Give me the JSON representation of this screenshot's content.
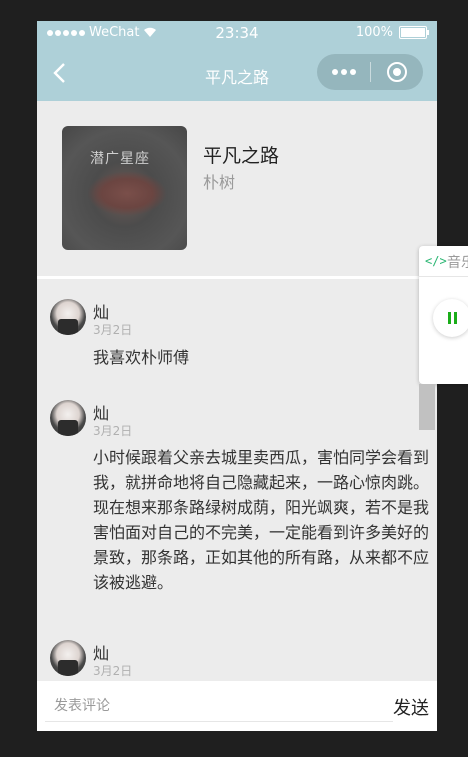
{
  "status": {
    "carrier": "WeChat",
    "time": "23:34",
    "battery": "100%"
  },
  "nav": {
    "title": "平凡之路"
  },
  "album": {
    "cover_text": "潜广星座",
    "title": "平凡之路",
    "artist": "朴树"
  },
  "comments": [
    {
      "name": "灿",
      "date": "3月2日",
      "text": "我喜欢朴师傅"
    },
    {
      "name": "灿",
      "date": "3月2日",
      "text": "小时候跟着父亲去城里卖西瓜，害怕同学会看到我，就拼命地将自己隐藏起来，一路心惊肉跳。现在想来那条路绿树成荫，阳光飒爽，若不是我害怕面对自己的不完美，一定能看到许多美好的景致，那条路，正如其他的所有路，从来都不应该被逃避。"
    },
    {
      "name": "灿",
      "date": "3月2日",
      "text": ""
    }
  ],
  "music_widget": {
    "code_icon": "</>",
    "label": "音乐"
  },
  "input": {
    "placeholder": "发表评论",
    "send_label": "发送"
  },
  "colors": {
    "header": "#aed0d8",
    "accent": "#1aad19"
  }
}
